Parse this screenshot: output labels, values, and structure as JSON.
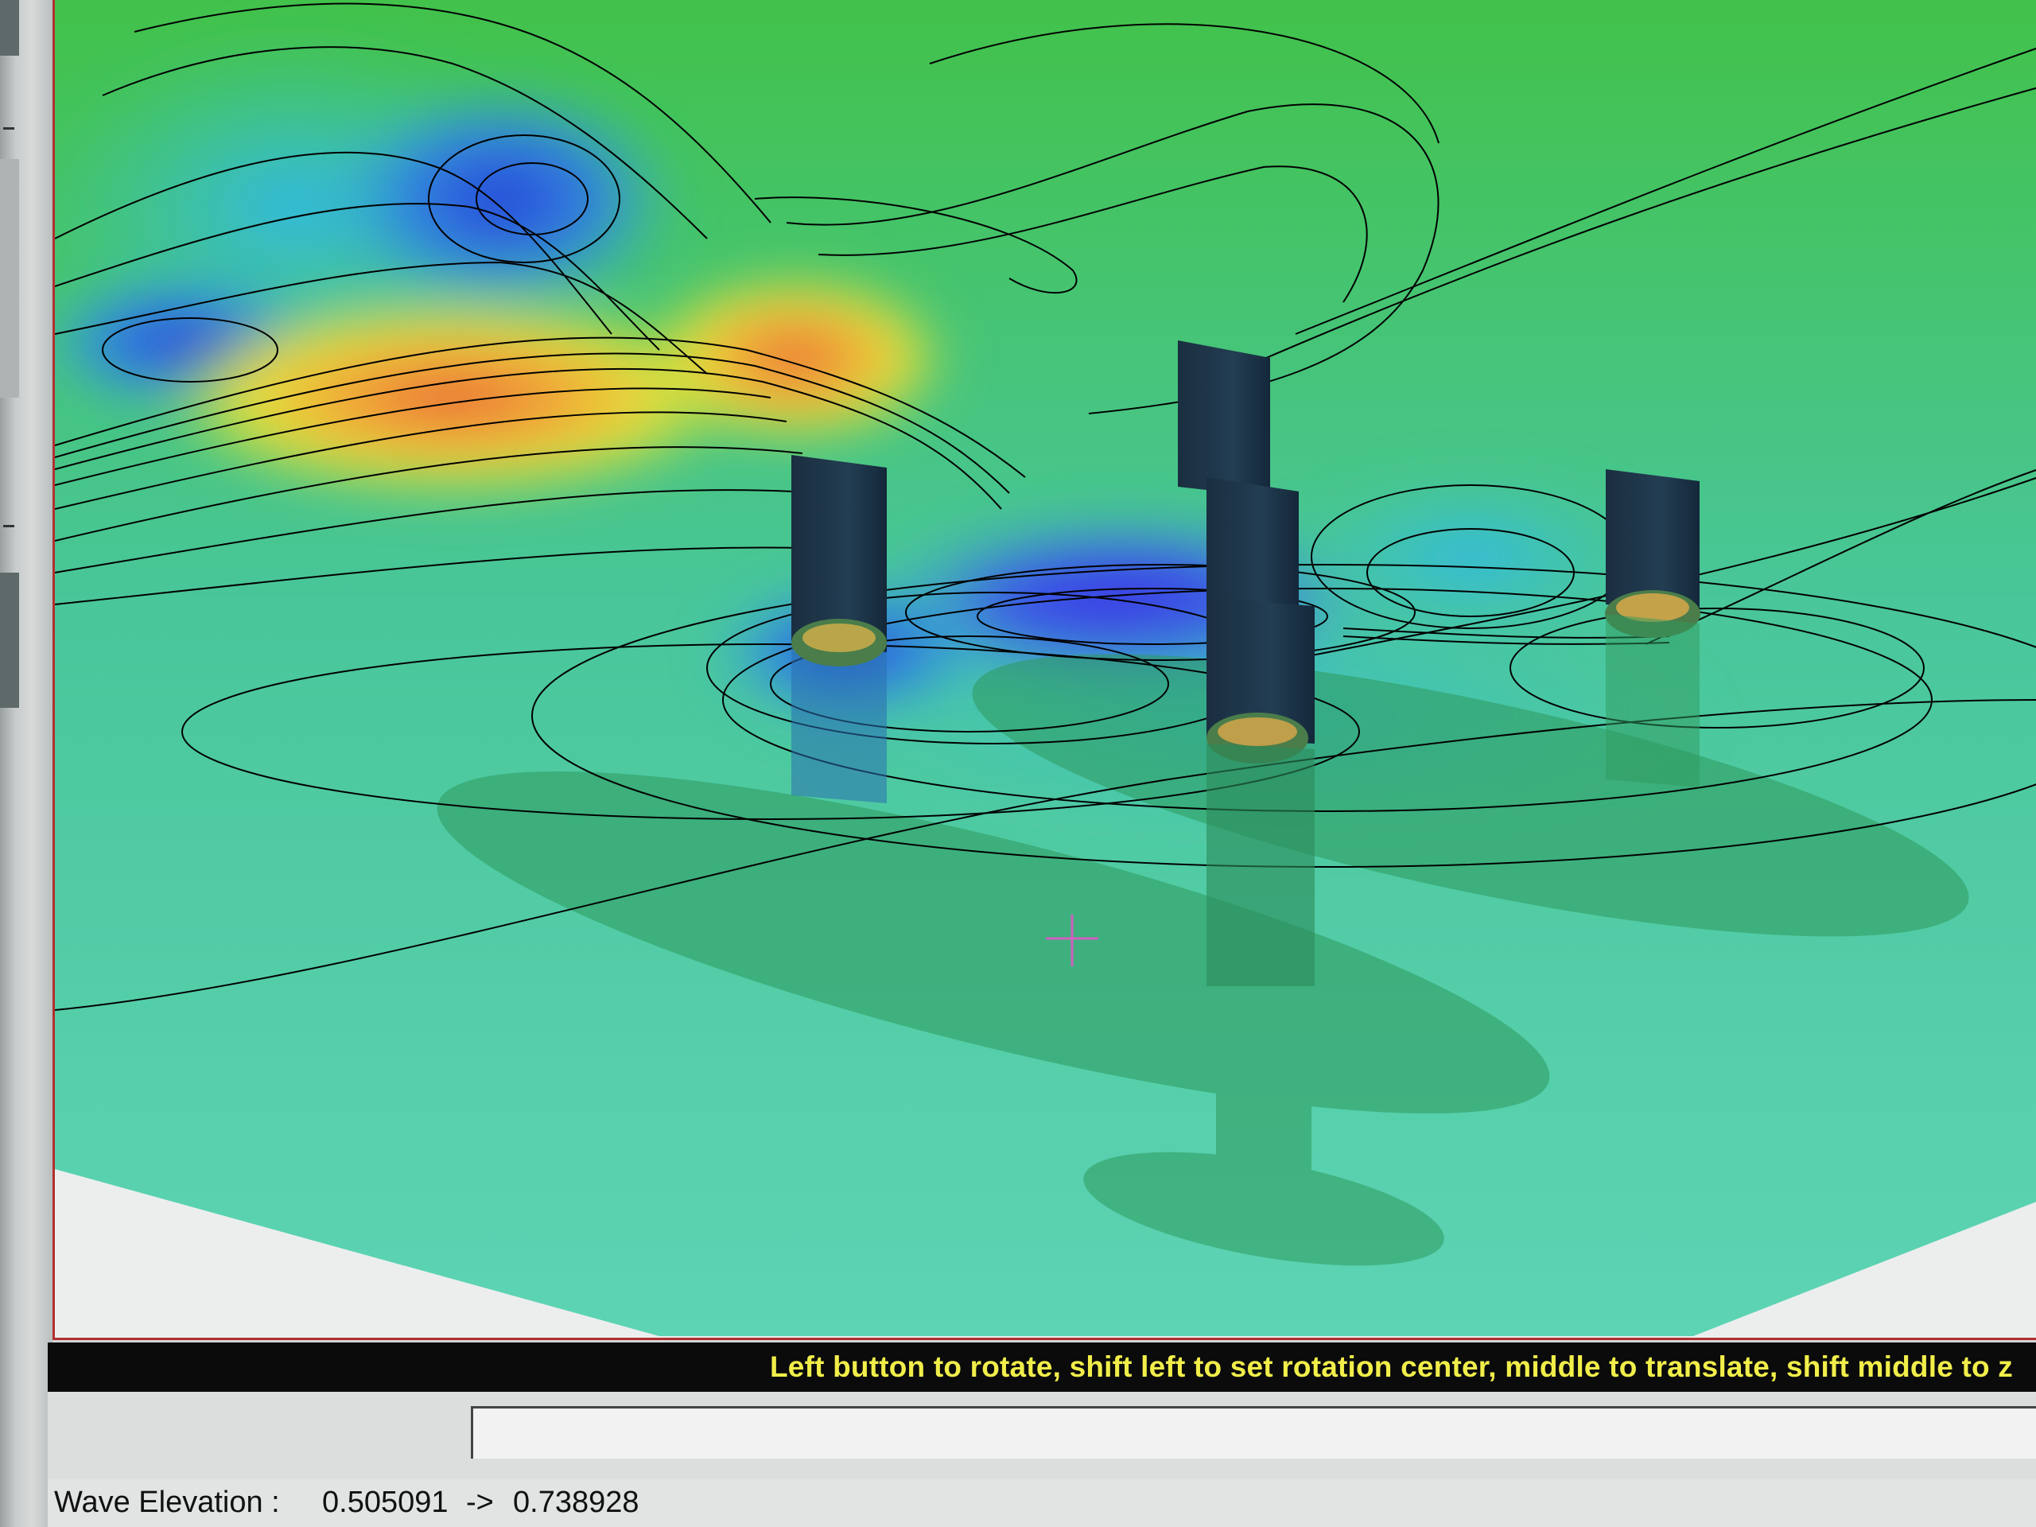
{
  "status_bar": {
    "message": "Left button to rotate, shift left to set rotation center, middle to translate, shift middle to z"
  },
  "command_input": {
    "value": ""
  },
  "readout": {
    "label": "Wave Elevation :",
    "min_value": "0.505091",
    "arrow": "->",
    "max_value": "0.738928"
  },
  "colors": {
    "status_bar_bg": "#0b0b0b",
    "status_text": "#f1ee4a",
    "cursor": "#d060c0",
    "hull": "#1c3346",
    "contour_line": "#000000"
  }
}
